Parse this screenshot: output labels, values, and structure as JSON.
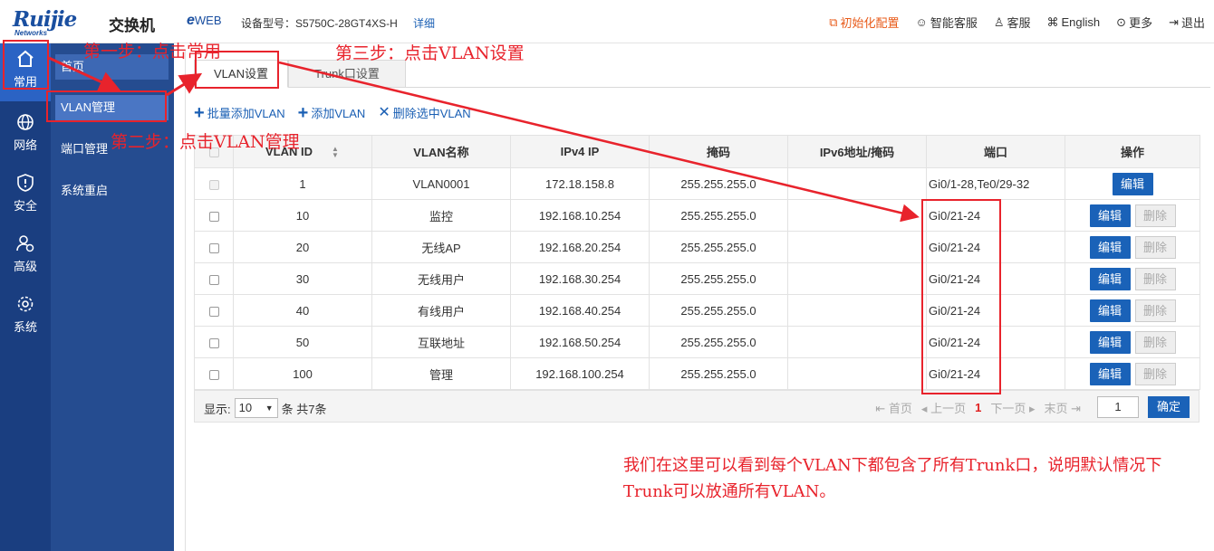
{
  "header": {
    "logo": "Ruijie",
    "logo_sub": "Networks",
    "product": "交换机",
    "eweb_e": "e",
    "eweb_rest": "WEB",
    "model_label": "设备型号：",
    "model_value": "S5750C-28GT4XS-H",
    "detail_link": "详细",
    "nav": {
      "init": "初始化配置",
      "smart": "智能客服",
      "service": "客服",
      "english": "English",
      "more": "更多",
      "logout": "退出"
    }
  },
  "rail": [
    {
      "label": "常用",
      "icon": "home-icon"
    },
    {
      "label": "网络",
      "icon": "globe-icon"
    },
    {
      "label": "安全",
      "icon": "shield-icon"
    },
    {
      "label": "高级",
      "icon": "user-gear-icon"
    },
    {
      "label": "系统",
      "icon": "gear-icon"
    }
  ],
  "submenu": [
    "首页",
    "VLAN管理",
    "端口管理",
    "系统重启"
  ],
  "tabs": [
    "VLAN设置",
    "Trunk口设置"
  ],
  "toolbar": {
    "batch_add": "批量添加VLAN",
    "add": "添加VLAN",
    "delete_selected": "删除选中VLAN"
  },
  "table": {
    "headers": [
      "VLAN ID",
      "VLAN名称",
      "IPv4 IP",
      "掩码",
      "IPv6地址/掩码",
      "端口",
      "操作"
    ],
    "rows": [
      {
        "id": "1",
        "name": "VLAN0001",
        "ip": "172.18.158.8",
        "mask": "255.255.255.0",
        "ipv6": "",
        "port": "Gi0/1-28,Te0/29-32"
      },
      {
        "id": "10",
        "name": "监控",
        "ip": "192.168.10.254",
        "mask": "255.255.255.0",
        "ipv6": "",
        "port": "Gi0/21-24"
      },
      {
        "id": "20",
        "name": "无线AP",
        "ip": "192.168.20.254",
        "mask": "255.255.255.0",
        "ipv6": "",
        "port": "Gi0/21-24"
      },
      {
        "id": "30",
        "name": "无线用户",
        "ip": "192.168.30.254",
        "mask": "255.255.255.0",
        "ipv6": "",
        "port": "Gi0/21-24"
      },
      {
        "id": "40",
        "name": "有线用户",
        "ip": "192.168.40.254",
        "mask": "255.255.255.0",
        "ipv6": "",
        "port": "Gi0/21-24"
      },
      {
        "id": "50",
        "name": "互联地址",
        "ip": "192.168.50.254",
        "mask": "255.255.255.0",
        "ipv6": "",
        "port": "Gi0/21-24"
      },
      {
        "id": "100",
        "name": "管理",
        "ip": "192.168.100.254",
        "mask": "255.255.255.0",
        "ipv6": "",
        "port": "Gi0/21-24"
      }
    ],
    "edit_label": "编辑",
    "delete_label": "删除"
  },
  "pager": {
    "show_label": "显示:",
    "page_size": "10",
    "total_label": "条 共7条",
    "first": "首页",
    "prev": "上一页",
    "current": "1",
    "next": "下一页",
    "last": "末页",
    "goto_value": "1",
    "confirm": "确定"
  },
  "annotations": {
    "step1": "第一步：点击常用",
    "step2": "第二步：点击VLAN管理",
    "step3": "第三步：点击VLAN设置",
    "note": "我们在这里可以看到每个VLAN下都包含了所有Trunk口，说明默认情况下Trunk可以放通所有VLAN。"
  },
  "colors": {
    "annotation": "#e8232c",
    "rail_bg": "#1a3e80",
    "submenu_bg": "#254c90",
    "primary_button": "#1a62b8"
  }
}
